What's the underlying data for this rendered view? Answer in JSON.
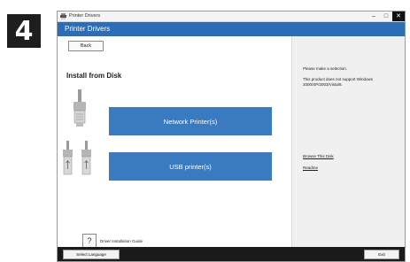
{
  "step_number": "4",
  "window": {
    "title": "Printer Drivers",
    "app_header": "Printer Drivers",
    "controls": {
      "minimize": "–",
      "maximize": "□",
      "close": "✕"
    }
  },
  "left_pane": {
    "back_label": "Back",
    "section_title": "Install from Disk",
    "network_button_label": "Network Printer(s)",
    "usb_button_label": "USB printer(s)",
    "help_icon": "?",
    "help_label": "Driver Installation Guide"
  },
  "right_pane": {
    "prompt": "Please make a selection.",
    "notice": "This product does not support Windows 2000/XP/2003/Vista/8.",
    "link_browse": "Browse This Disk",
    "link_readme": "Readme"
  },
  "bottom_bar": {
    "language_label": "Select Language",
    "exit_label": "Exit"
  },
  "colors": {
    "accent": "#3a7ac0",
    "header": "#2c6db5",
    "bottom_bar": "#1a1a1a",
    "badge": "#1e1e1e"
  }
}
